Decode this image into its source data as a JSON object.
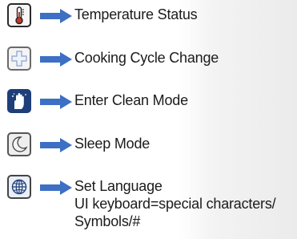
{
  "legend": {
    "items": [
      {
        "icon": "thermometer-icon",
        "label": "Temperature Status"
      },
      {
        "icon": "plus-icon",
        "label": "Cooking Cycle Change"
      },
      {
        "icon": "clean-hand-icon",
        "label": "Enter Clean Mode"
      },
      {
        "icon": "moon-icon",
        "label": "Sleep Mode"
      },
      {
        "icon": "globe-icon",
        "label_lines": [
          "Set Language",
          "UI keyboard=special characters/",
          "Symbols/#"
        ]
      }
    ],
    "arrow_color": "#3d6fc4",
    "accent_dark": "#1f3f7a",
    "thermometer_fill": "#c0392b"
  }
}
